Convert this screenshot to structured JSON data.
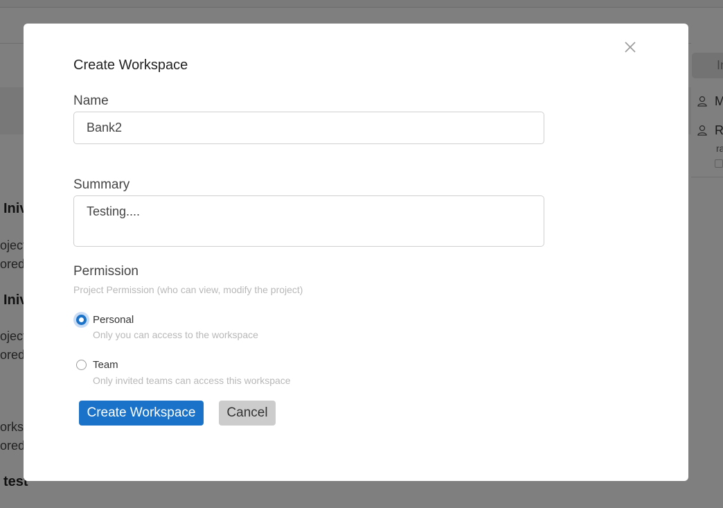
{
  "background": {
    "headings": [
      "Inivi",
      "Inivi",
      "test"
    ],
    "text_lines": [
      "oject",
      "orede",
      "oject",
      "orede",
      "orksp",
      "orede"
    ],
    "right_panel": {
      "invite_label": "In",
      "members": [
        "M",
        "R"
      ],
      "member_sub": "ra"
    }
  },
  "modal": {
    "title": "Create Workspace",
    "name": {
      "label": "Name",
      "value": "Bank2"
    },
    "summary": {
      "label": "Summary",
      "value": "Testing...."
    },
    "permission": {
      "label": "Permission",
      "subtitle": "Project Permission (who can view, modify the project)",
      "options": [
        {
          "label": "Personal",
          "description": "Only you can access to the workspace",
          "selected": true
        },
        {
          "label": "Team",
          "description": "Only invited teams can access this workspace",
          "selected": false
        }
      ]
    },
    "buttons": {
      "create": "Create Workspace",
      "cancel": "Cancel"
    },
    "icons": {
      "close": "close-icon",
      "radio": "radio-icon"
    },
    "colors": {
      "primary": "#1a73c8",
      "overlay": "rgba(0,0,0,0.5)"
    }
  }
}
